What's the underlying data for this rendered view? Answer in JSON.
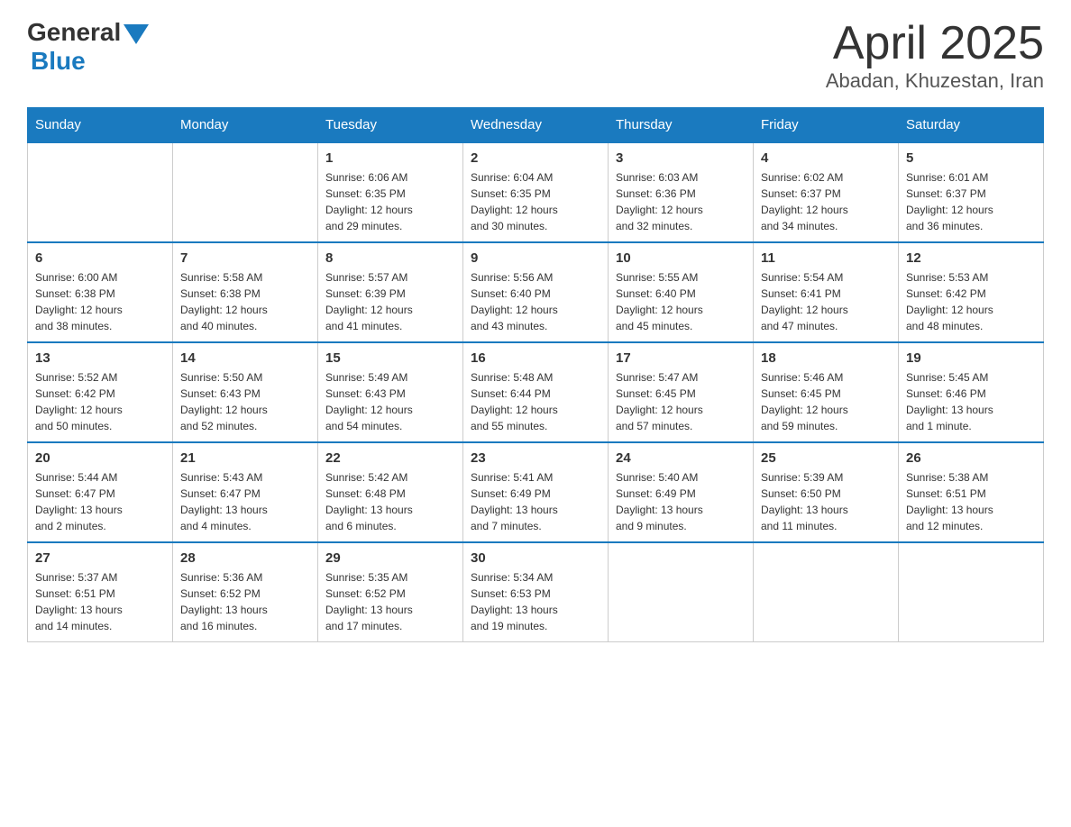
{
  "header": {
    "logo_general": "General",
    "logo_blue": "Blue",
    "title": "April 2025",
    "subtitle": "Abadan, Khuzestan, Iran"
  },
  "days_of_week": [
    "Sunday",
    "Monday",
    "Tuesday",
    "Wednesday",
    "Thursday",
    "Friday",
    "Saturday"
  ],
  "weeks": [
    [
      {
        "day": "",
        "info": ""
      },
      {
        "day": "",
        "info": ""
      },
      {
        "day": "1",
        "info": "Sunrise: 6:06 AM\nSunset: 6:35 PM\nDaylight: 12 hours\nand 29 minutes."
      },
      {
        "day": "2",
        "info": "Sunrise: 6:04 AM\nSunset: 6:35 PM\nDaylight: 12 hours\nand 30 minutes."
      },
      {
        "day": "3",
        "info": "Sunrise: 6:03 AM\nSunset: 6:36 PM\nDaylight: 12 hours\nand 32 minutes."
      },
      {
        "day": "4",
        "info": "Sunrise: 6:02 AM\nSunset: 6:37 PM\nDaylight: 12 hours\nand 34 minutes."
      },
      {
        "day": "5",
        "info": "Sunrise: 6:01 AM\nSunset: 6:37 PM\nDaylight: 12 hours\nand 36 minutes."
      }
    ],
    [
      {
        "day": "6",
        "info": "Sunrise: 6:00 AM\nSunset: 6:38 PM\nDaylight: 12 hours\nand 38 minutes."
      },
      {
        "day": "7",
        "info": "Sunrise: 5:58 AM\nSunset: 6:38 PM\nDaylight: 12 hours\nand 40 minutes."
      },
      {
        "day": "8",
        "info": "Sunrise: 5:57 AM\nSunset: 6:39 PM\nDaylight: 12 hours\nand 41 minutes."
      },
      {
        "day": "9",
        "info": "Sunrise: 5:56 AM\nSunset: 6:40 PM\nDaylight: 12 hours\nand 43 minutes."
      },
      {
        "day": "10",
        "info": "Sunrise: 5:55 AM\nSunset: 6:40 PM\nDaylight: 12 hours\nand 45 minutes."
      },
      {
        "day": "11",
        "info": "Sunrise: 5:54 AM\nSunset: 6:41 PM\nDaylight: 12 hours\nand 47 minutes."
      },
      {
        "day": "12",
        "info": "Sunrise: 5:53 AM\nSunset: 6:42 PM\nDaylight: 12 hours\nand 48 minutes."
      }
    ],
    [
      {
        "day": "13",
        "info": "Sunrise: 5:52 AM\nSunset: 6:42 PM\nDaylight: 12 hours\nand 50 minutes."
      },
      {
        "day": "14",
        "info": "Sunrise: 5:50 AM\nSunset: 6:43 PM\nDaylight: 12 hours\nand 52 minutes."
      },
      {
        "day": "15",
        "info": "Sunrise: 5:49 AM\nSunset: 6:43 PM\nDaylight: 12 hours\nand 54 minutes."
      },
      {
        "day": "16",
        "info": "Sunrise: 5:48 AM\nSunset: 6:44 PM\nDaylight: 12 hours\nand 55 minutes."
      },
      {
        "day": "17",
        "info": "Sunrise: 5:47 AM\nSunset: 6:45 PM\nDaylight: 12 hours\nand 57 minutes."
      },
      {
        "day": "18",
        "info": "Sunrise: 5:46 AM\nSunset: 6:45 PM\nDaylight: 12 hours\nand 59 minutes."
      },
      {
        "day": "19",
        "info": "Sunrise: 5:45 AM\nSunset: 6:46 PM\nDaylight: 13 hours\nand 1 minute."
      }
    ],
    [
      {
        "day": "20",
        "info": "Sunrise: 5:44 AM\nSunset: 6:47 PM\nDaylight: 13 hours\nand 2 minutes."
      },
      {
        "day": "21",
        "info": "Sunrise: 5:43 AM\nSunset: 6:47 PM\nDaylight: 13 hours\nand 4 minutes."
      },
      {
        "day": "22",
        "info": "Sunrise: 5:42 AM\nSunset: 6:48 PM\nDaylight: 13 hours\nand 6 minutes."
      },
      {
        "day": "23",
        "info": "Sunrise: 5:41 AM\nSunset: 6:49 PM\nDaylight: 13 hours\nand 7 minutes."
      },
      {
        "day": "24",
        "info": "Sunrise: 5:40 AM\nSunset: 6:49 PM\nDaylight: 13 hours\nand 9 minutes."
      },
      {
        "day": "25",
        "info": "Sunrise: 5:39 AM\nSunset: 6:50 PM\nDaylight: 13 hours\nand 11 minutes."
      },
      {
        "day": "26",
        "info": "Sunrise: 5:38 AM\nSunset: 6:51 PM\nDaylight: 13 hours\nand 12 minutes."
      }
    ],
    [
      {
        "day": "27",
        "info": "Sunrise: 5:37 AM\nSunset: 6:51 PM\nDaylight: 13 hours\nand 14 minutes."
      },
      {
        "day": "28",
        "info": "Sunrise: 5:36 AM\nSunset: 6:52 PM\nDaylight: 13 hours\nand 16 minutes."
      },
      {
        "day": "29",
        "info": "Sunrise: 5:35 AM\nSunset: 6:52 PM\nDaylight: 13 hours\nand 17 minutes."
      },
      {
        "day": "30",
        "info": "Sunrise: 5:34 AM\nSunset: 6:53 PM\nDaylight: 13 hours\nand 19 minutes."
      },
      {
        "day": "",
        "info": ""
      },
      {
        "day": "",
        "info": ""
      },
      {
        "day": "",
        "info": ""
      }
    ]
  ]
}
